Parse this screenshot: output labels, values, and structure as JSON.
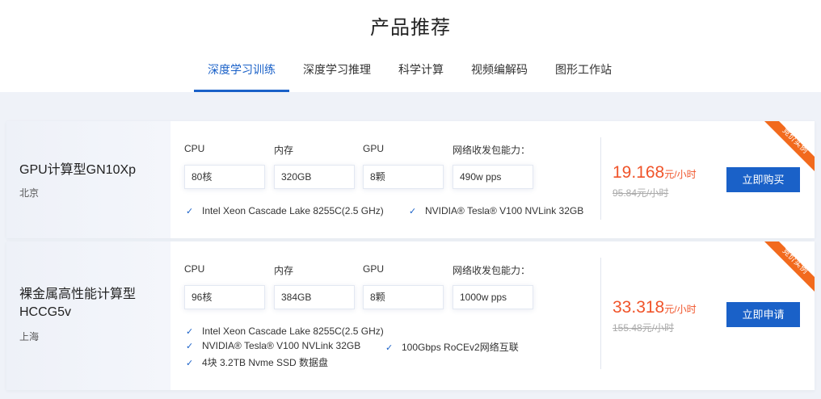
{
  "page": {
    "title": "产品推荐"
  },
  "tabs": [
    {
      "label": "深度学习训练",
      "active": true
    },
    {
      "label": "深度学习推理",
      "active": false
    },
    {
      "label": "科学计算",
      "active": false
    },
    {
      "label": "视频编解码",
      "active": false
    },
    {
      "label": "图形工作站",
      "active": false
    }
  ],
  "colors": {
    "accent": "#1a61c8",
    "price": "#f0542a",
    "ribbon": "#f26a1d"
  },
  "products": [
    {
      "name_lines": [
        "GPU计算型GN10Xp"
      ],
      "region": "北京",
      "ribbon_text": "竞价实例",
      "specs": [
        {
          "label": "CPU",
          "value": "80核"
        },
        {
          "label": "内存",
          "value": "320GB"
        },
        {
          "label": "GPU",
          "value": "8颗"
        },
        {
          "label": "网络收发包能力：",
          "value": "490w pps"
        }
      ],
      "features": [
        "Intel Xeon Cascade Lake 8255C(2.5 GHz)",
        "NVIDIA® Tesla® V100 NVLink 32GB"
      ],
      "price": "19.168",
      "price_unit": "元/小时",
      "old_price": "95.84元/小时",
      "button_label": "立即购买"
    },
    {
      "name_lines": [
        "裸金属高性能计算型",
        "HCCG5v"
      ],
      "region": "上海",
      "ribbon_text": "竞价实例",
      "specs": [
        {
          "label": "CPU",
          "value": "96核"
        },
        {
          "label": "内存",
          "value": "384GB"
        },
        {
          "label": "GPU",
          "value": "8颗"
        },
        {
          "label": "网络收发包能力：",
          "value": "1000w pps"
        }
      ],
      "features": [
        "Intel Xeon Cascade Lake 8255C(2.5 GHz)",
        "NVIDIA® Tesla® V100 NVLink 32GB",
        "100Gbps RoCEv2网络互联",
        "4块 3.2TB Nvme SSD 数据盘"
      ],
      "price": "33.318",
      "price_unit": "元/小时",
      "old_price": "155.48元/小时",
      "button_label": "立即申请"
    }
  ]
}
